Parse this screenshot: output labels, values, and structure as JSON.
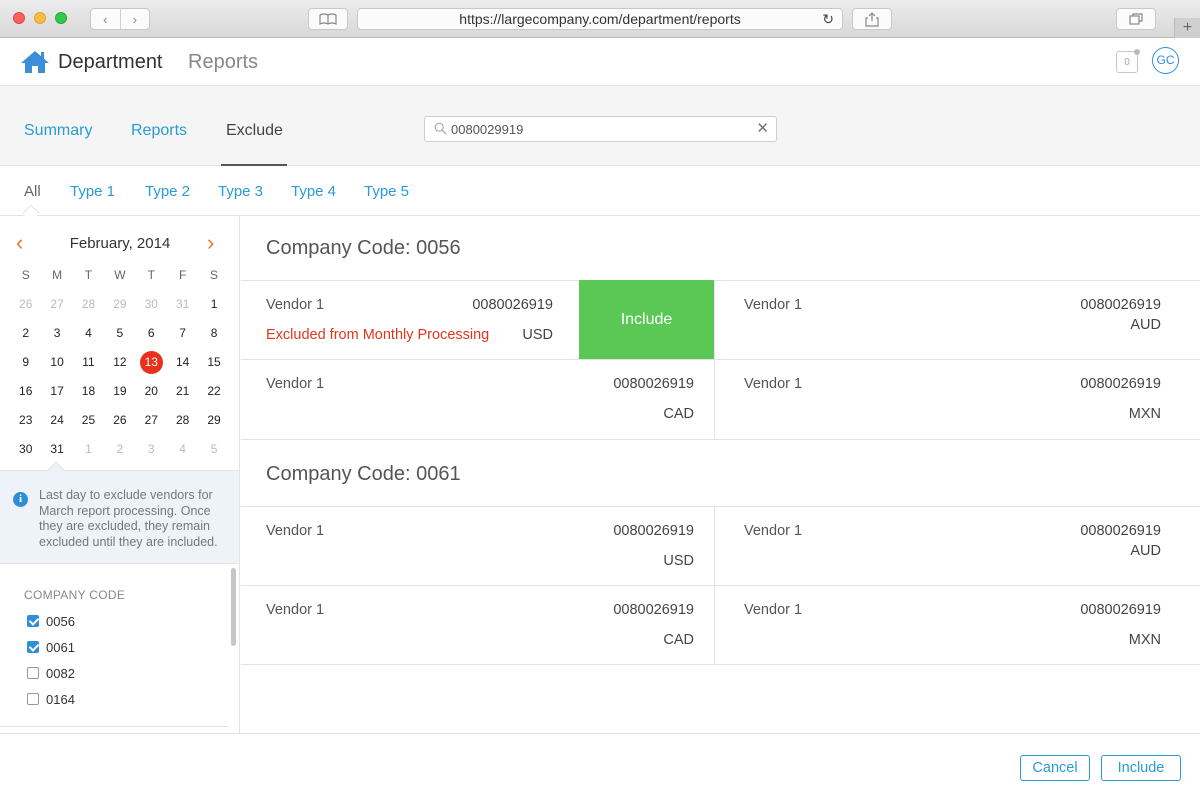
{
  "browser": {
    "url": "https://largecompany.com/department/reports",
    "back_icon": "chevron-left-icon",
    "forward_icon": "chevron-right-icon",
    "reload_icon": "reload-icon"
  },
  "header": {
    "brand": "Department",
    "section": "Reports",
    "notification_count": "0",
    "avatar_initials": "GC"
  },
  "tabs": [
    {
      "label": "Summary",
      "active": false
    },
    {
      "label": "Reports",
      "active": false
    },
    {
      "label": "Exclude",
      "active": true
    }
  ],
  "search": {
    "value": "0080029919",
    "placeholder": ""
  },
  "type_filters": [
    {
      "label": "All",
      "active": true
    },
    {
      "label": "Type 1"
    },
    {
      "label": "Type 2"
    },
    {
      "label": "Type 3"
    },
    {
      "label": "Type 4"
    },
    {
      "label": "Type 5"
    }
  ],
  "calendar": {
    "title": "February, 2014",
    "weekdays": [
      "S",
      "M",
      "T",
      "W",
      "T",
      "F",
      "S"
    ],
    "weeks": [
      [
        "26",
        "27",
        "28",
        "29",
        "30",
        "31",
        "1"
      ],
      [
        "2",
        "3",
        "4",
        "5",
        "6",
        "7",
        "8"
      ],
      [
        "9",
        "10",
        "11",
        "12",
        "13",
        "14",
        "15"
      ],
      [
        "16",
        "17",
        "18",
        "19",
        "20",
        "21",
        "22"
      ],
      [
        "23",
        "24",
        "25",
        "26",
        "27",
        "28",
        "29"
      ],
      [
        "30",
        "31",
        "1",
        "2",
        "3",
        "4",
        "5"
      ]
    ],
    "selected_day": "13",
    "accent_color": "#e8782e",
    "today_color": "#e8301c"
  },
  "info": {
    "text": "Last day to exclude vendors for March report processing. Once they are excluded, they remain excluded until they are included."
  },
  "company_code_filter": {
    "heading": "COMPANY CODE",
    "items": [
      {
        "label": "0056",
        "checked": true
      },
      {
        "label": "0061",
        "checked": true
      },
      {
        "label": "0082",
        "checked": false
      },
      {
        "label": "0164",
        "checked": false
      }
    ]
  },
  "groups": [
    {
      "title": "Company Code: 0056",
      "cells": [
        {
          "vendor": "Vendor 1",
          "number": "0080026919",
          "currency": "USD",
          "status": "Excluded from Monthly Processing",
          "action": "Include"
        },
        {
          "vendor": "Vendor 1",
          "number": "0080026919",
          "currency": "AUD"
        },
        {
          "vendor": "Vendor 1",
          "number": "0080026919",
          "currency": "CAD"
        },
        {
          "vendor": "Vendor 1",
          "number": "0080026919",
          "currency": "MXN"
        }
      ]
    },
    {
      "title": "Company Code: 0061",
      "cells": [
        {
          "vendor": "Vendor 1",
          "number": "0080026919",
          "currency": "USD"
        },
        {
          "vendor": "Vendor 1",
          "number": "0080026919",
          "currency": "AUD"
        },
        {
          "vendor": "Vendor 1",
          "number": "0080026919",
          "currency": "CAD"
        },
        {
          "vendor": "Vendor 1",
          "number": "0080026919",
          "currency": "MXN"
        }
      ]
    }
  ],
  "footer": {
    "cancel_label": "Cancel",
    "include_label": "Include"
  },
  "colors": {
    "link": "#2a9bd6",
    "include_green": "#5bc754",
    "warning_red": "#e2361e"
  }
}
